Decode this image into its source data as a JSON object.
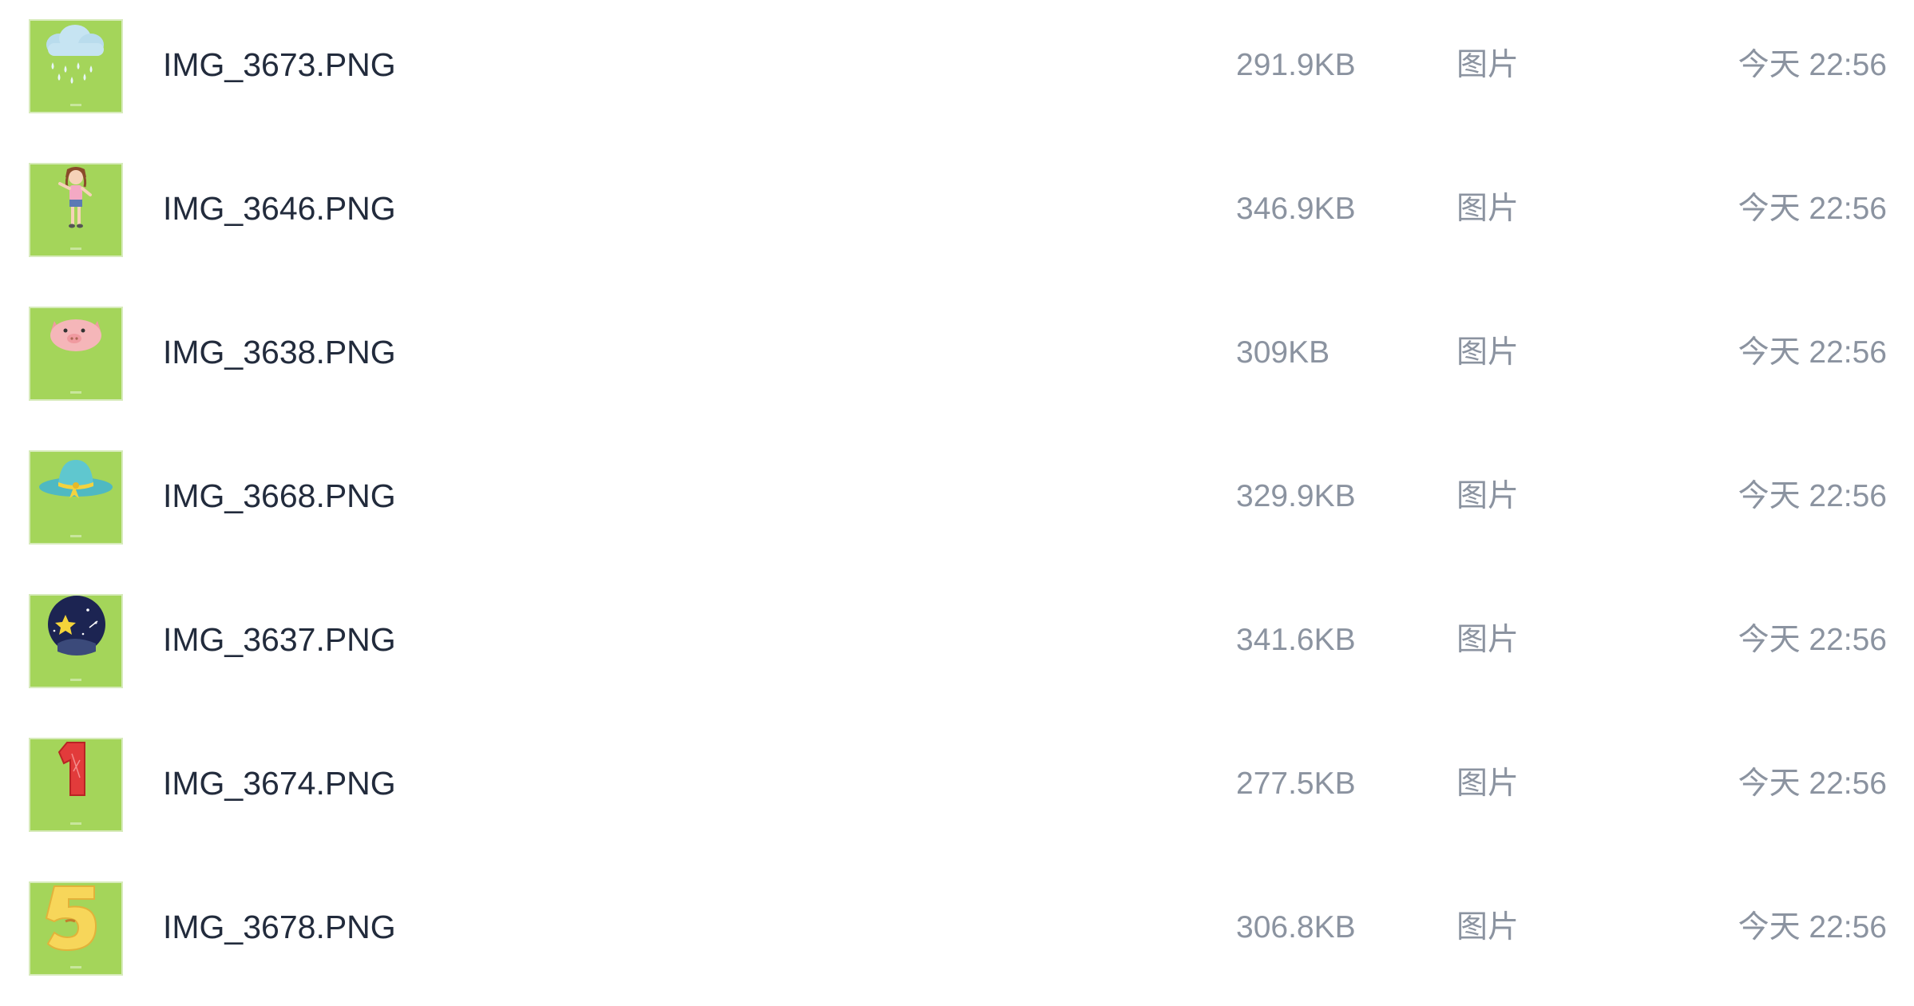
{
  "files": [
    {
      "name": "IMG_3673.PNG",
      "size": "291.9KB",
      "type": "图片",
      "date": "今天 22:56",
      "thumbnail": "rain-cloud-icon"
    },
    {
      "name": "IMG_3646.PNG",
      "size": "346.9KB",
      "type": "图片",
      "date": "今天 22:56",
      "thumbnail": "girl-icon"
    },
    {
      "name": "IMG_3638.PNG",
      "size": "309KB",
      "type": "图片",
      "date": "今天 22:56",
      "thumbnail": "pig-icon"
    },
    {
      "name": "IMG_3668.PNG",
      "size": "329.9KB",
      "type": "图片",
      "date": "今天 22:56",
      "thumbnail": "sun-hat-icon"
    },
    {
      "name": "IMG_3637.PNG",
      "size": "341.6KB",
      "type": "图片",
      "date": "今天 22:56",
      "thumbnail": "night-star-icon"
    },
    {
      "name": "IMG_3674.PNG",
      "size": "277.5KB",
      "type": "图片",
      "date": "今天 22:56",
      "thumbnail": "number-one-icon"
    },
    {
      "name": "IMG_3678.PNG",
      "size": "306.8KB",
      "type": "图片",
      "date": "今天 22:56",
      "thumbnail": "number-five-icon"
    }
  ],
  "colors": {
    "thumbnail_background": "#a4d55a",
    "filename_text": "#222b3c",
    "meta_text": "#8b93a0"
  }
}
